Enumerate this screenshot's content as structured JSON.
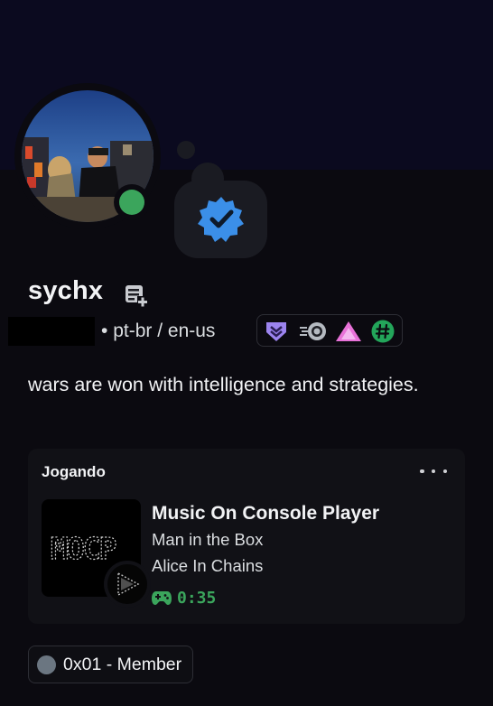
{
  "profile": {
    "username": "sychx",
    "pronouns": "pt-br / en-us",
    "pronoun_separator": "•",
    "bio": "wars are won with intelligence and strategies.",
    "status_color": "#3ba55c",
    "status": "online"
  },
  "badges": [
    "hypesquad-icon",
    "nitro-boost-icon",
    "triangle-badge-icon",
    "hashtag-badge-icon"
  ],
  "activity": {
    "header": "Jogando",
    "title": "Music On Console Player",
    "details": "Man in the Box",
    "state": "Alice In Chains",
    "elapsed": "0:35",
    "image_text": "MOCP"
  },
  "roles": [
    {
      "name": "0x01 - Member",
      "color": "#6b7681"
    }
  ],
  "colors": {
    "background": "#0b0a10",
    "banner": "#0b0a1f",
    "accent_green": "#3ba55c",
    "verified_blue": "#3b8fe8"
  }
}
